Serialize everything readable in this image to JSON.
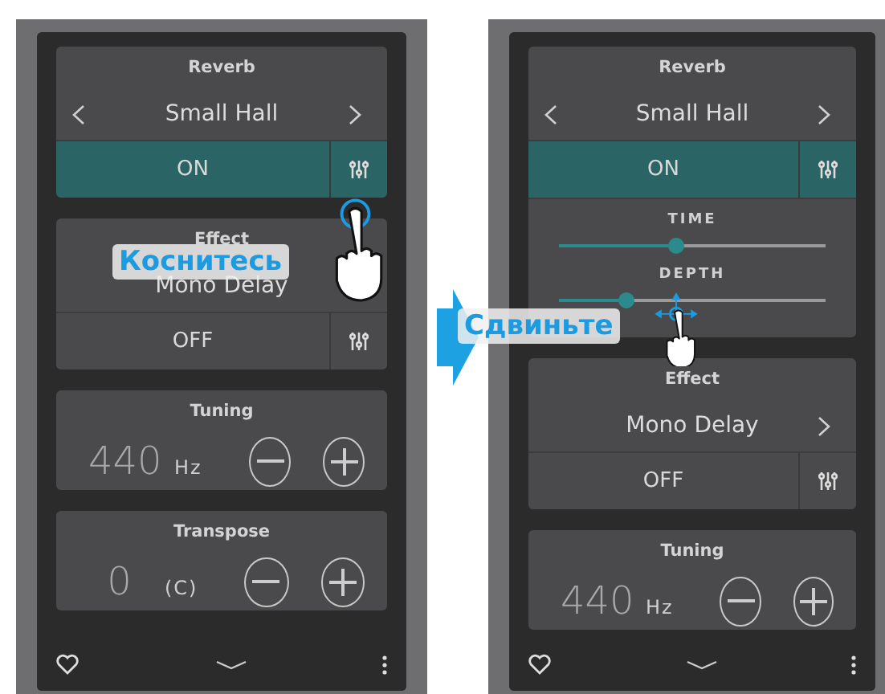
{
  "screens": [
    {
      "sections": [
        {
          "kind": "effect",
          "title": "Reverb",
          "value": "Small Hall",
          "has_prev": true,
          "has_next": true,
          "toggle": "ON",
          "on": true
        },
        {
          "kind": "effect",
          "title": "Effect",
          "value": "Mono Delay",
          "has_prev": false,
          "toggle": "OFF",
          "on": false
        },
        {
          "kind": "stepper",
          "title": "Tuning",
          "value": "440",
          "unit": "Hz"
        },
        {
          "kind": "stepper",
          "title": "Transpose",
          "value": "0",
          "unit": "(C)"
        }
      ],
      "gesture": {
        "kind": "tap",
        "label": "Коснитесь"
      }
    },
    {
      "sections": [
        {
          "kind": "effect",
          "title": "Reverb",
          "value": "Small Hall",
          "has_prev": true,
          "has_next": true,
          "toggle": "ON",
          "on": true,
          "params": [
            {
              "label": "TIME",
              "level": 0.44
            },
            {
              "label": "DEPTH",
              "level": 0.25
            }
          ]
        },
        {
          "kind": "effect",
          "title": "Effect",
          "value": "Mono Delay",
          "has_prev": false,
          "has_next": true,
          "toggle": "OFF",
          "on": false
        },
        {
          "kind": "stepper",
          "title": "Tuning",
          "value": "440",
          "unit": "Hz"
        }
      ],
      "gesture": {
        "kind": "drag",
        "label": "Сдвиньте"
      }
    }
  ]
}
